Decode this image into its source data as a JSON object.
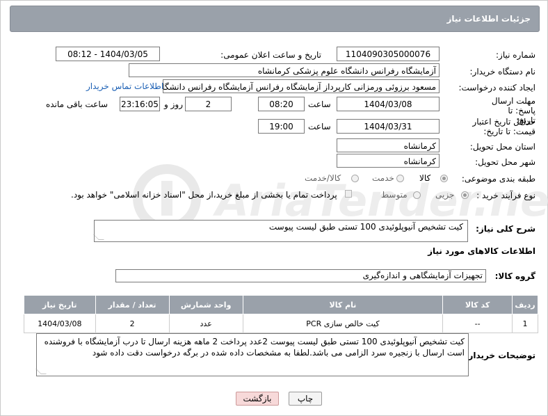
{
  "title": "جزئیات اطلاعات نیاز",
  "fields": {
    "need_number_label": "شماره نیاز:",
    "need_number": "1104090305000076",
    "announce_label": "تاریخ و ساعت اعلان عمومی:",
    "announce_value": "1404/03/05 - 08:12",
    "buyer_org_label": "نام دستگاه خریدار:",
    "buyer_org": "آزمایشگاه رفرانس دانشگاه علوم پزشکی کرمانشاه",
    "creator_label": "ایجاد کننده درخواست:",
    "creator": "مسعود برزوئی ورمزانی کارپرداز آزمایشگاه رفرانس آزمایشگاه رفرانس دانشگاه ع",
    "buyer_contact_link": "اطلاعات تماس خریدار",
    "deadline_label": "مهلت ارسال پاسخ: تا تاریخ:",
    "deadline_date": "1404/03/08",
    "time_word": "ساعت",
    "deadline_time": "08:20",
    "days_count": "2",
    "days_word": "روز و",
    "remaining_time": "23:16:05",
    "remaining_word": "ساعت باقی مانده",
    "validity_label": "حداقل تاریخ اعتبار قیمت: تا تاریخ:",
    "validity_date": "1404/03/31",
    "validity_time": "19:00",
    "province_label": "استان محل تحویل:",
    "province": "کرمانشاه",
    "city_label": "شهر محل تحویل:",
    "city": "کرمانشاه",
    "category_label": "طبقه بندی موضوعی:",
    "category_options": [
      "کالا",
      "خدمت",
      "کالا/خدمت"
    ],
    "process_label": "نوع فرآیند خرید :",
    "process_options": [
      "جزیی",
      "متوسط"
    ],
    "payment_text": "پرداخت تمام یا بخشی از مبلغ خرید،از محل \"اسناد خزانه اسلامی\" خواهد بود."
  },
  "general_desc_label": "شرح کلی نیاز:",
  "general_desc": "کیت تشخیص آنیوپلوئیدی 100 تستی  طبق لیست پیوست",
  "goods_info_title": "اطلاعات کالاهای مورد نیاز",
  "goods_group_label": "گروه کالا:",
  "goods_group": "تجهیزات آزمایشگاهی و اندازه‌گیری",
  "table": {
    "headers": [
      "ردیف",
      "کد کالا",
      "نام کالا",
      "واحد شمارش",
      "تعداد / مقدار",
      "تاریخ نیاز"
    ],
    "rows": [
      [
        "1",
        "--",
        "کیت خالص سازی PCR",
        "عدد",
        "2",
        "1404/03/08"
      ]
    ]
  },
  "buyer_notes_label": "توضیحات خریدار:",
  "buyer_notes": "کیت تشخیص آنیوپلوئیدی 100 تستی  طبق لیست پیوست 2عدد پرداخت 2 ماهه هزینه ارسال تا درب آزمایشگاه با فروشنده است ارسال با زنجیره سرد الزامی می باشد.لطفا به مشخصات داده شده در برگه درخواست دقت داده شود",
  "buttons": {
    "print": "چاپ",
    "back": "بازگشت"
  },
  "colors": {
    "header_bg": "#9aa1aa",
    "back_button_bg": "#f7d9d9",
    "link": "#1a5fb4"
  }
}
